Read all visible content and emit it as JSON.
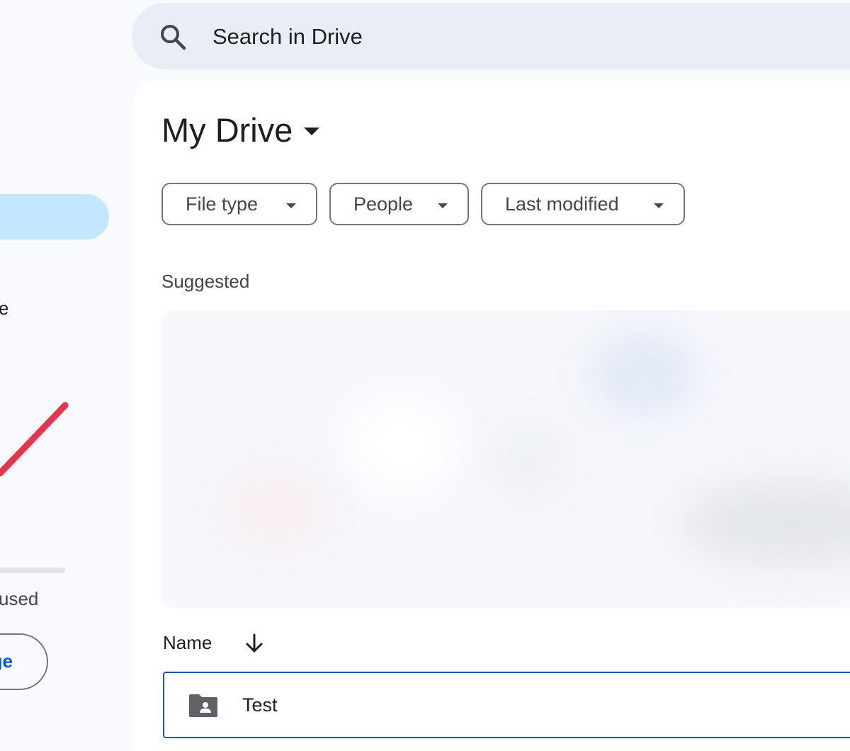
{
  "search": {
    "placeholder": "Search in Drive",
    "icon": "search-icon"
  },
  "sidebar": {
    "active_item_visible_text": "",
    "partial_item_text": "e",
    "storage": {
      "used_text": "used",
      "button_text": "ge"
    }
  },
  "main": {
    "title": "My Drive",
    "filters": [
      {
        "label": "File type"
      },
      {
        "label": "People"
      },
      {
        "label": "Last modified"
      }
    ],
    "suggested_heading": "Suggested",
    "list": {
      "column_name": "Name",
      "sort_direction": "descending",
      "rows": [
        {
          "name": "Test",
          "type": "shared-folder"
        }
      ]
    }
  },
  "colors": {
    "accent": "#0b57d0",
    "nav_active": "#c2e7ff",
    "search_bg": "#e9eef6",
    "annotation": "#e8334a"
  }
}
